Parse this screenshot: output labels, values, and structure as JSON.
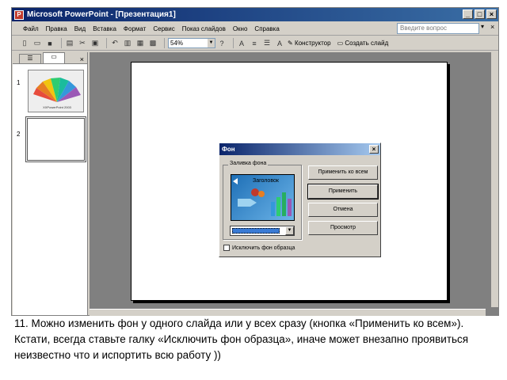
{
  "window": {
    "title": "Microsoft PowerPoint - [Презентация1]",
    "btn_min": "_",
    "btn_max": "□",
    "btn_close": "×"
  },
  "menu": {
    "items": [
      "Файл",
      "Правка",
      "Вид",
      "Вставка",
      "Формат",
      "Сервис",
      "Показ слайдов",
      "Окно",
      "Справка"
    ],
    "help_placeholder": "Введите вопрос",
    "help_arrow": "▾",
    "close": "×"
  },
  "toolbar": {
    "zoom": "54%",
    "design_label": "Конструктор",
    "new_slide_label": "Создать слайд"
  },
  "panel": {
    "slide1_num": "1",
    "slide2_num": "2",
    "thumb_caption": "XXPowerPoint 2003"
  },
  "dialog": {
    "title": "Фон",
    "close": "×",
    "group_label": "Заливка фона",
    "preview_title": "Заголовок",
    "exclude_label": "Исключить фон образца",
    "btn_apply_all": "Применить ко всем",
    "btn_apply": "Применить",
    "btn_cancel": "Отмена",
    "btn_preview": "Просмотр"
  },
  "caption": {
    "text": "11.   Можно изменить фон у одного слайда или у всех сразу (кнопка «Применить ко всем»). Кстати, всегда ставьте галку «Исключить фон образца», иначе может внезапно проявиться неизвестно что и испортить всю работу ))"
  },
  "colors": {
    "titlebar": "#0a246a",
    "chrome": "#d4d0c8",
    "workarea": "#808080"
  }
}
